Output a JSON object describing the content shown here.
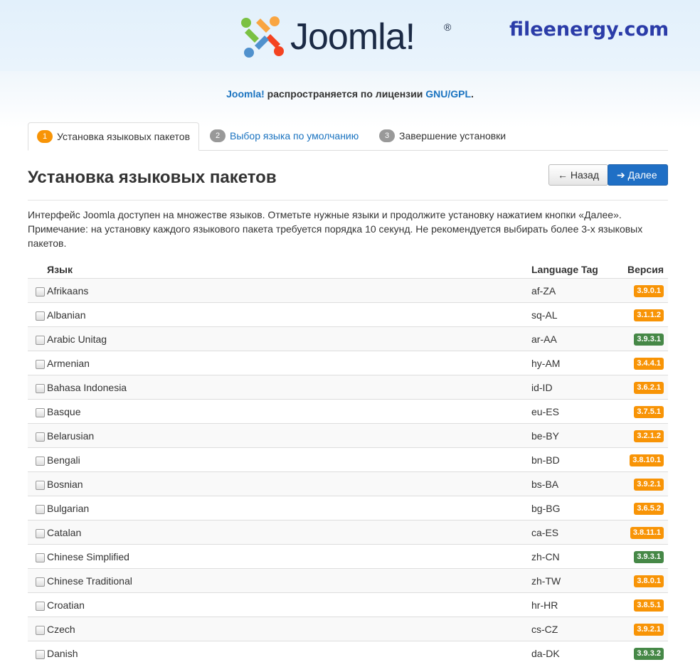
{
  "header": {
    "logo_text": "Joomla!",
    "logo_registered": "®",
    "watermark": "fileenergy.com",
    "license": {
      "joomla_link": "Joomla!",
      "text": " распространяется по лицензии ",
      "gpl_link": "GNU/GPL",
      "end": "."
    }
  },
  "tabs": [
    {
      "num": "1",
      "label": "Установка языковых пакетов",
      "active": true
    },
    {
      "num": "2",
      "label": "Выбор языка по умолчанию",
      "active": false
    },
    {
      "num": "3",
      "label": "Завершение установки",
      "active": false
    }
  ],
  "page": {
    "title": "Установка языковых пакетов",
    "back_label": "Назад",
    "next_label": "Далее",
    "description": "Интерфейс Joomla доступен на множестве языков. Отметьте нужные языки и продолжите установку нажатием кнопки «Далее». Примечание: на установку каждого языкового пакета требуется порядка 10 секунд. Не рекомендуется выбирать более 3-х языковых пакетов."
  },
  "table": {
    "headers": {
      "language": "Язык",
      "tag": "Language Tag",
      "version": "Версия"
    },
    "rows": [
      {
        "name": "Afrikaans",
        "tag": "af-ZA",
        "version": "3.9.0.1",
        "color": "orange"
      },
      {
        "name": "Albanian",
        "tag": "sq-AL",
        "version": "3.1.1.2",
        "color": "orange"
      },
      {
        "name": "Arabic Unitag",
        "tag": "ar-AA",
        "version": "3.9.3.1",
        "color": "green"
      },
      {
        "name": "Armenian",
        "tag": "hy-AM",
        "version": "3.4.4.1",
        "color": "orange"
      },
      {
        "name": "Bahasa Indonesia",
        "tag": "id-ID",
        "version": "3.6.2.1",
        "color": "orange"
      },
      {
        "name": "Basque",
        "tag": "eu-ES",
        "version": "3.7.5.1",
        "color": "orange"
      },
      {
        "name": "Belarusian",
        "tag": "be-BY",
        "version": "3.2.1.2",
        "color": "orange"
      },
      {
        "name": "Bengali",
        "tag": "bn-BD",
        "version": "3.8.10.1",
        "color": "orange"
      },
      {
        "name": "Bosnian",
        "tag": "bs-BA",
        "version": "3.9.2.1",
        "color": "orange"
      },
      {
        "name": "Bulgarian",
        "tag": "bg-BG",
        "version": "3.6.5.2",
        "color": "orange"
      },
      {
        "name": "Catalan",
        "tag": "ca-ES",
        "version": "3.8.11.1",
        "color": "orange"
      },
      {
        "name": "Chinese Simplified",
        "tag": "zh-CN",
        "version": "3.9.3.1",
        "color": "green"
      },
      {
        "name": "Chinese Traditional",
        "tag": "zh-TW",
        "version": "3.8.0.1",
        "color": "orange"
      },
      {
        "name": "Croatian",
        "tag": "hr-HR",
        "version": "3.8.5.1",
        "color": "orange"
      },
      {
        "name": "Czech",
        "tag": "cs-CZ",
        "version": "3.9.2.1",
        "color": "orange"
      },
      {
        "name": "Danish",
        "tag": "da-DK",
        "version": "3.9.3.2",
        "color": "green"
      }
    ]
  },
  "colors": {
    "badge_orange": "#f89406",
    "badge_green": "#468847",
    "primary": "#1f6fc5",
    "link": "#1a73c0"
  }
}
